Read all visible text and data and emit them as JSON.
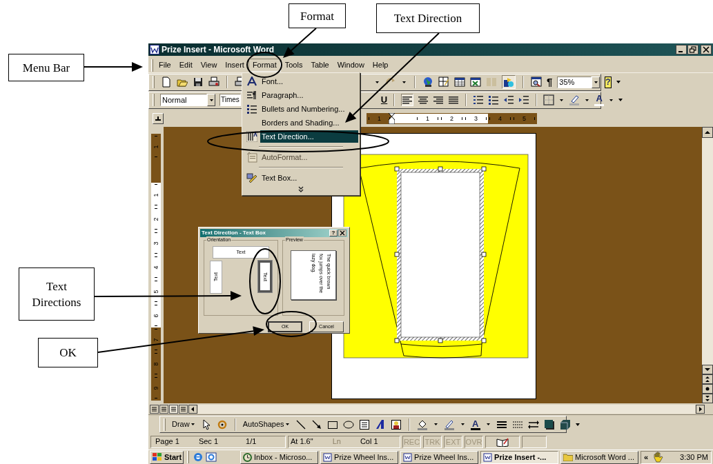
{
  "annotations": [
    {
      "text": "Menu Bar"
    },
    {
      "text": "Format"
    },
    {
      "text": "Text Direction"
    },
    {
      "text": "Text Directions"
    },
    {
      "text": "OK"
    }
  ],
  "window": {
    "title": "Prize Insert - Microsoft Word"
  },
  "menu_bar": [
    {
      "label": "File",
      "selected": false
    },
    {
      "label": "Edit",
      "selected": false
    },
    {
      "label": "View",
      "selected": false
    },
    {
      "label": "Insert",
      "selected": false
    },
    {
      "label": "Format",
      "selected": true
    },
    {
      "label": "Tools",
      "selected": false
    },
    {
      "label": "Table",
      "selected": false
    },
    {
      "label": "Window",
      "selected": false
    },
    {
      "label": "Help",
      "selected": false
    }
  ],
  "standard_toolbar": {
    "show_formatting": "¶",
    "zoom": "35%",
    "help": "?"
  },
  "formatting_toolbar": {
    "style": "Normal",
    "font": "Times",
    "underline": "U",
    "font_color": "A"
  },
  "horizontal_ruler": [
    {
      "label": "1",
      "margin": true
    },
    {
      "label": "1",
      "margin": false
    },
    {
      "label": "2",
      "margin": false
    },
    {
      "label": "3",
      "margin": false
    },
    {
      "label": "4",
      "margin": true
    },
    {
      "label": "5",
      "margin": true
    }
  ],
  "vertical_ruler": [
    {
      "label": "1",
      "margin": true
    },
    {
      "label": "1",
      "margin": false
    },
    {
      "label": "2",
      "margin": false
    },
    {
      "label": "3",
      "margin": false
    },
    {
      "label": "4",
      "margin": false
    },
    {
      "label": "5",
      "margin": false
    },
    {
      "label": "6",
      "margin": false
    },
    {
      "label": "7",
      "margin": true
    },
    {
      "label": "8",
      "margin": true
    },
    {
      "label": "9",
      "margin": true
    }
  ],
  "format_menu": [
    {
      "kind": "item",
      "label": "Font...",
      "selected": false,
      "disabled": false
    },
    {
      "kind": "item",
      "label": "Paragraph...",
      "selected": false,
      "disabled": false
    },
    {
      "kind": "item",
      "label": "Bullets and Numbering...",
      "selected": false,
      "disabled": false
    },
    {
      "kind": "item",
      "label": "Borders and Shading...",
      "selected": false,
      "disabled": false
    },
    {
      "kind": "item",
      "label": "Text Direction...",
      "selected": true,
      "disabled": false
    },
    {
      "kind": "separator"
    },
    {
      "kind": "item",
      "label": "AutoFormat...",
      "selected": false,
      "disabled": true
    },
    {
      "kind": "separator"
    },
    {
      "kind": "item",
      "label": "Text Box...",
      "selected": false,
      "disabled": false
    },
    {
      "kind": "expand"
    }
  ],
  "dialog": {
    "title": "Text Direction - Text Box",
    "help": "?",
    "orientation_label": "Orientation",
    "options": [
      {
        "kind": "horizontal",
        "text": "Text",
        "selected": false
      },
      {
        "kind": "vertical_up",
        "text": "Text",
        "selected": false
      },
      {
        "kind": "vertical_down",
        "text": "Text",
        "selected": true
      }
    ],
    "preview_label": "Preview",
    "preview_text": "The quick brown fox jumps over the lazy dog.",
    "buttons": [
      {
        "label": "OK",
        "default": true
      },
      {
        "label": "Cancel",
        "default": false
      }
    ]
  },
  "drawing_toolbar": {
    "draw": "Draw",
    "autoshapes": "AutoShapes",
    "font_color": "A"
  },
  "status_bar": {
    "page": "Page 1",
    "section": "Sec 1",
    "pages": "1/1",
    "at": "At 1.6\"",
    "line": "Ln",
    "column": "Col 1",
    "modes": [
      {
        "label": "REC",
        "on": false
      },
      {
        "label": "TRK",
        "on": false
      },
      {
        "label": "EXT",
        "on": false
      },
      {
        "label": "OVR",
        "on": false
      }
    ]
  },
  "taskbar": {
    "start": "Start",
    "tasks": [
      {
        "label": "Inbox - Microso...",
        "kind": "mail",
        "selected": false
      },
      {
        "label": "Prize Wheel Ins...",
        "kind": "document",
        "selected": false
      },
      {
        "label": "Prize Wheel Ins...",
        "kind": "document",
        "selected": false
      },
      {
        "label": "Prize Insert -...",
        "kind": "document",
        "selected": true
      },
      {
        "label": "Microsoft Word ...",
        "kind": "folder",
        "selected": false
      }
    ],
    "tray_expand": "«",
    "clock": "3:30 PM"
  }
}
